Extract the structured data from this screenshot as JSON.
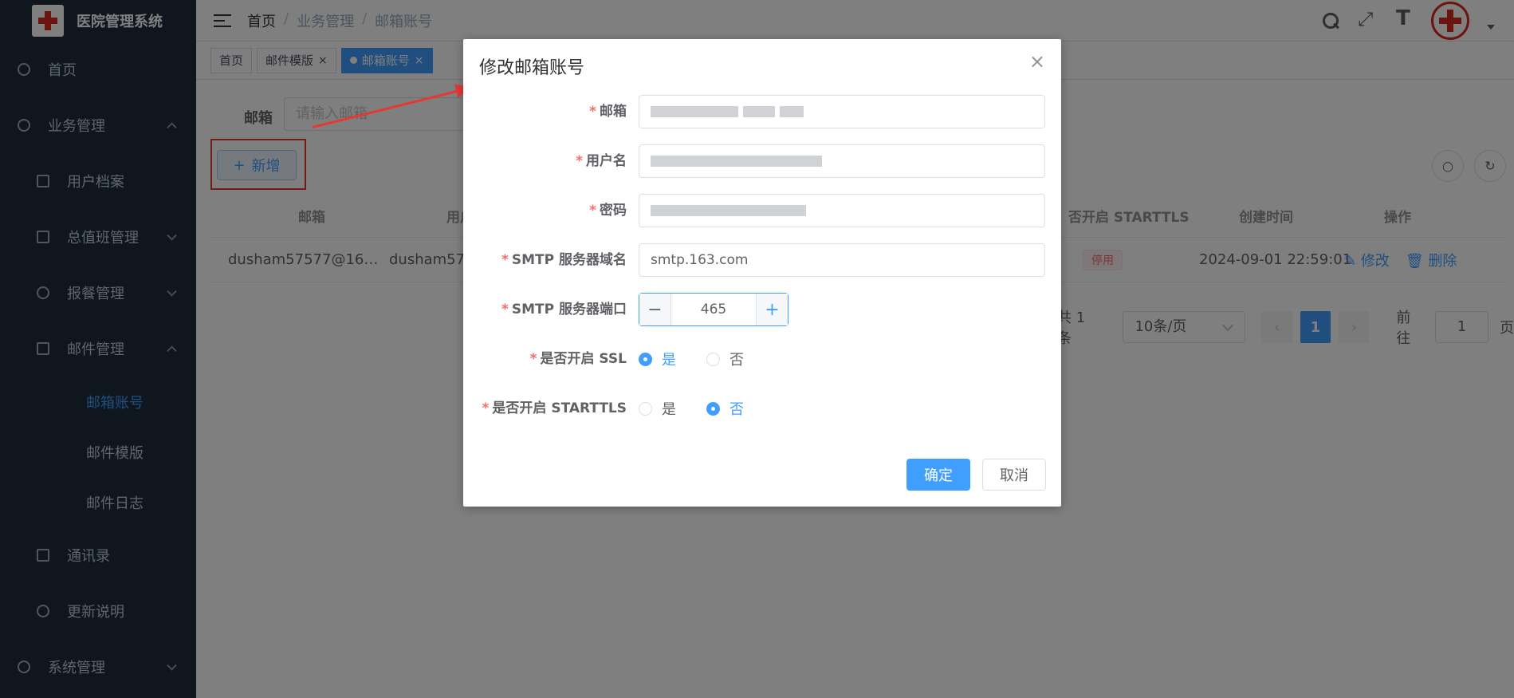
{
  "app": {
    "title": "医院管理系统"
  },
  "sidebar": {
    "items": [
      {
        "label": "首页"
      },
      {
        "label": "业务管理"
      },
      {
        "label": "用户档案"
      },
      {
        "label": "总值班管理"
      },
      {
        "label": "报餐管理"
      },
      {
        "label": "邮件管理"
      },
      {
        "label": "邮箱账号"
      },
      {
        "label": "邮件模版"
      },
      {
        "label": "邮件日志"
      },
      {
        "label": "通讯录"
      },
      {
        "label": "更新说明"
      },
      {
        "label": "系统管理"
      }
    ]
  },
  "breadcrumb": [
    "首页",
    "业务管理",
    "邮箱账号"
  ],
  "tags": [
    {
      "label": "首页"
    },
    {
      "label": "邮件模版"
    },
    {
      "label": "邮箱账号"
    }
  ],
  "filter": {
    "label": "邮箱",
    "placeholder": "请输入邮箱"
  },
  "toolbar": {
    "add_label": "新增"
  },
  "table": {
    "headers": {
      "email": "邮箱",
      "user": "用户",
      "starttls": "否开启 STARTTLS",
      "created": "创建时间",
      "ops": "操作"
    },
    "row": {
      "email": "dusham57577@16…",
      "user": "dusham575",
      "status": "停用",
      "created": "2024-09-01 22:59:01",
      "edit": "修改",
      "delete": "删除"
    }
  },
  "pager": {
    "total": "共 1 条",
    "size": "10条/页",
    "current": "1",
    "goto_label": "前往",
    "goto_value": "1",
    "page_unit": "页"
  },
  "dialog": {
    "title": "修改邮箱账号",
    "fields": {
      "email_label": "邮箱",
      "username_label": "用户名",
      "password_label": "密码",
      "smtp_host_label": "SMTP 服务器域名",
      "smtp_host_value": "smtp.163.com",
      "smtp_port_label": "SMTP 服务器端口",
      "smtp_port_value": "465",
      "ssl_label": "是否开启 SSL",
      "starttls_label": "是否开启 STARTTLS"
    },
    "radio": {
      "yes": "是",
      "no": "否"
    },
    "ok": "确定",
    "cancel": "取消"
  },
  "colors": {
    "primary": "#409eff",
    "sidebar_bg": "#1f2d3d",
    "danger": "#f56c6c",
    "highlight": "#e53935"
  }
}
